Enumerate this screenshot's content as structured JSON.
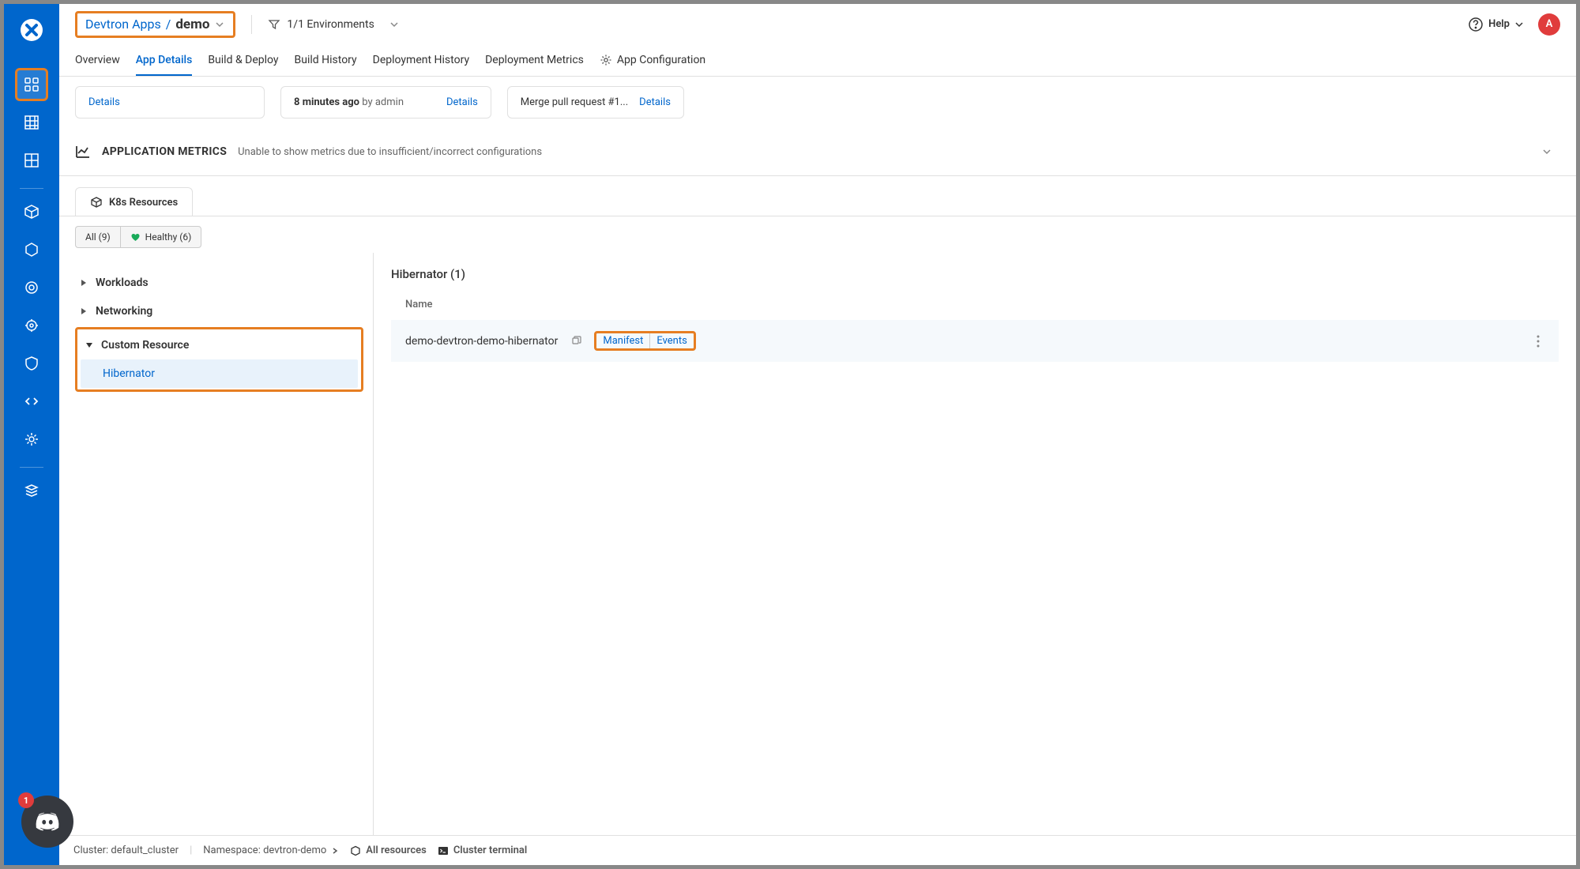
{
  "header": {
    "breadcrumb_parent": "Devtron Apps",
    "breadcrumb_separator": "/",
    "breadcrumb_current": "demo",
    "env_filter": "1/1 Environments",
    "help_label": "Help",
    "user_initial": "A"
  },
  "tabs": {
    "overview": "Overview",
    "app_details": "App Details",
    "build_deploy": "Build & Deploy",
    "build_history": "Build History",
    "deployment_history": "Deployment History",
    "deployment_metrics": "Deployment Metrics",
    "app_configuration": "App Configuration"
  },
  "cards": [
    {
      "text": "",
      "link": "Details"
    },
    {
      "text": "8 minutes ago",
      "by": "by admin",
      "link": "Details"
    },
    {
      "text": "Merge pull request #1...",
      "link": "Details"
    }
  ],
  "metrics": {
    "title": "APPLICATION METRICS",
    "message": "Unable to show metrics due to insufficient/incorrect configurations"
  },
  "resources_tab": "K8s Resources",
  "filters": {
    "all": "All (9)",
    "healthy": "Healthy (6)"
  },
  "tree": {
    "workloads": "Workloads",
    "networking": "Networking",
    "custom_resource": "Custom Resource",
    "hibernator": "Hibernator"
  },
  "content": {
    "title": "Hibernator (1)",
    "col_name": "Name",
    "row_name": "demo-devtron-demo-hibernator",
    "manifest": "Manifest",
    "events": "Events"
  },
  "footer": {
    "cluster": "Cluster: default_cluster",
    "namespace": "Namespace: devtron-demo",
    "all_resources": "All resources",
    "cluster_terminal": "Cluster terminal"
  },
  "discord_badge": "1"
}
